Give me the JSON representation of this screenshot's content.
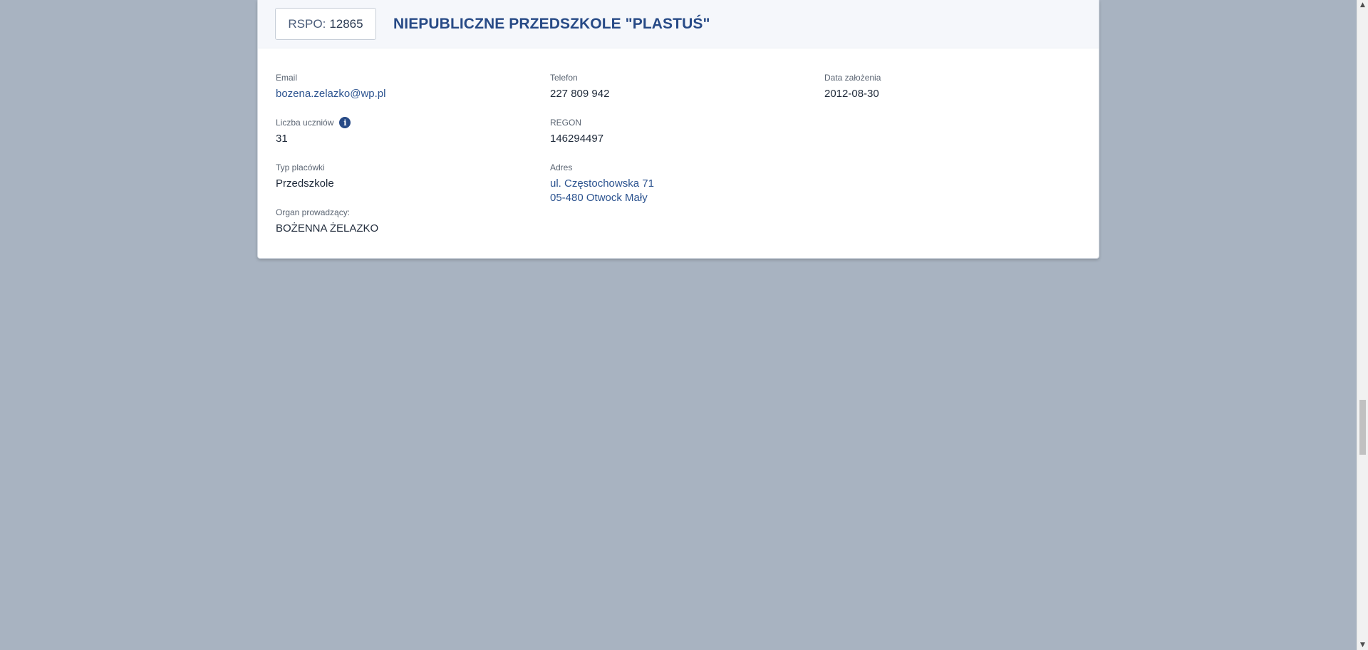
{
  "card": {
    "rspo_label": "RSPO:",
    "rspo_number": "12865",
    "title": "NIEPUBLICZNE PRZEDSZKOLE \"PLASTUŚ\""
  },
  "fields": {
    "email": {
      "label": "Email",
      "value": "bozena.zelazko@wp.pl"
    },
    "phone": {
      "label": "Telefon",
      "value": "227 809 942"
    },
    "founded": {
      "label": "Data założenia",
      "value": "2012-08-30"
    },
    "students": {
      "label": "Liczba uczniów",
      "value": "31",
      "icon": "info-icon"
    },
    "regon": {
      "label": "REGON",
      "value": "146294497"
    },
    "type": {
      "label": "Typ placówki",
      "value": "Przedszkole"
    },
    "address": {
      "label": "Adres",
      "line1": "ul. Częstochowska 71",
      "line2": "05-480 Otwock Mały"
    },
    "organ": {
      "label": "Organ prowadzący:",
      "value": "BOŻENNA ŻELAZKO"
    }
  },
  "scrollbar": {
    "up_arrow": "▲",
    "down_arrow": "▼"
  }
}
